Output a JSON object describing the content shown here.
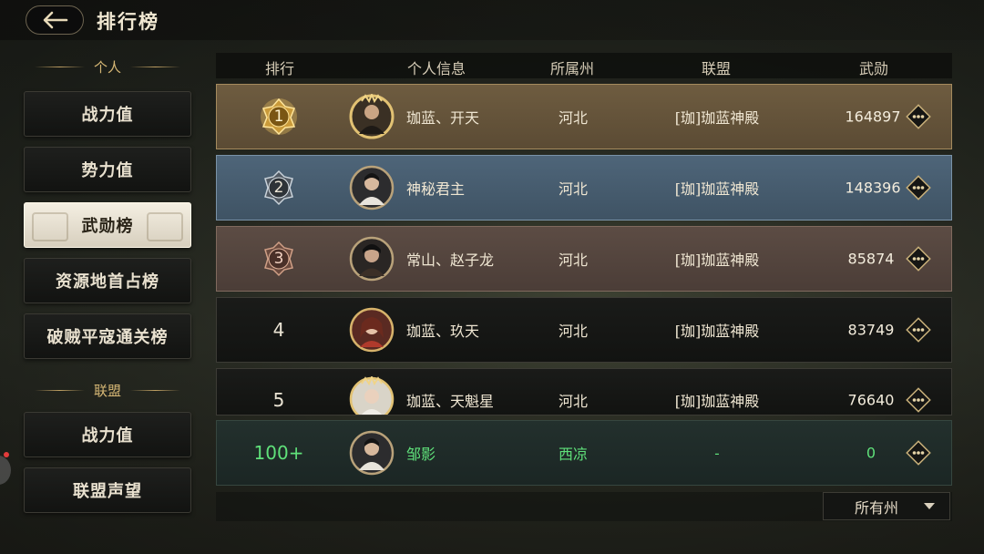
{
  "header": {
    "title": "排行榜",
    "back_icon": "back-arrow-icon"
  },
  "sidebar": {
    "personal_header": "个人",
    "personal_items": [
      "战力值",
      "势力值",
      "武勋榜",
      "资源地首占榜",
      "破贼平寇通关榜"
    ],
    "active_index": 2,
    "alliance_header": "联盟",
    "alliance_items": [
      "战力值",
      "联盟声望"
    ]
  },
  "table": {
    "columns": [
      "排行",
      "个人信息",
      "所属州",
      "联盟",
      "武勋"
    ],
    "rows": [
      {
        "rank": "1",
        "rank_style": "gold",
        "name": "珈蓝、开天",
        "state": "河北",
        "alliance": "[珈]珈蓝神殿",
        "merit": "164897"
      },
      {
        "rank": "2",
        "rank_style": "silver",
        "name": "神秘君主",
        "state": "河北",
        "alliance": "[珈]珈蓝神殿",
        "merit": "148396"
      },
      {
        "rank": "3",
        "rank_style": "bronze",
        "name": "常山、赵子龙",
        "state": "河北",
        "alliance": "[珈]珈蓝神殿",
        "merit": "85874"
      },
      {
        "rank": "4",
        "rank_style": "plain",
        "name": "珈蓝、玖天",
        "state": "河北",
        "alliance": "[珈]珈蓝神殿",
        "merit": "83749"
      },
      {
        "rank": "5",
        "rank_style": "plain",
        "name": "珈蓝、天魁星",
        "state": "河北",
        "alliance": "[珈]珈蓝神殿",
        "merit": "76640"
      }
    ],
    "self_row": {
      "rank": "100+",
      "name": "邹影",
      "state": "西凉",
      "alliance": "-",
      "merit": "0"
    }
  },
  "filter": {
    "state_selected": "所有州"
  },
  "colors": {
    "accent_gold": "#d6b775",
    "self_highlight": "#5fe07a"
  }
}
